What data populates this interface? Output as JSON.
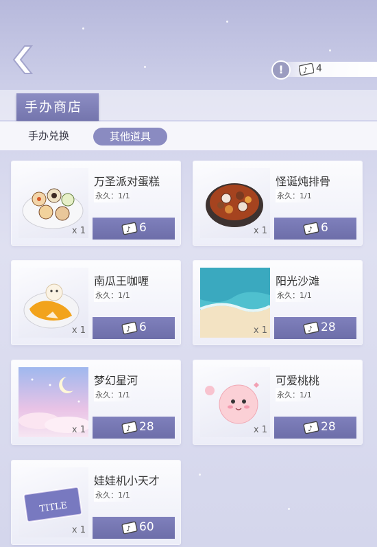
{
  "header": {
    "ticket_count": "4",
    "info_symbol": "!"
  },
  "title": "手办商店",
  "tabs": {
    "exchange": "手办兑换",
    "other_items": "其他道具"
  },
  "items": [
    {
      "name": "万圣派对蛋糕",
      "permanence": "永久：1/1",
      "qty": "x 1",
      "price": "6",
      "icon": "cake-plate-icon"
    },
    {
      "name": "怪诞炖排骨",
      "permanence": "永久：1/1",
      "qty": "x 1",
      "price": "6",
      "icon": "stew-pot-icon"
    },
    {
      "name": "南瓜王咖喱",
      "permanence": "永久：1/1",
      "qty": "x 1",
      "price": "6",
      "icon": "curry-plate-icon"
    },
    {
      "name": "阳光沙滩",
      "permanence": "永久：1/1",
      "qty": "x 1",
      "price": "28",
      "icon": "beach-scene-icon"
    },
    {
      "name": "梦幻星河",
      "permanence": "永久：1/1",
      "qty": "x 1",
      "price": "28",
      "icon": "starry-sky-icon"
    },
    {
      "name": "可爱桃桃",
      "permanence": "永久：1/1",
      "qty": "x 1",
      "price": "28",
      "icon": "peach-character-icon"
    },
    {
      "name": "娃娃机小天才",
      "permanence": "永久：1/1",
      "qty": "x 1",
      "price": "60",
      "icon": "title-card-icon",
      "card_text": "TITLE"
    }
  ]
}
